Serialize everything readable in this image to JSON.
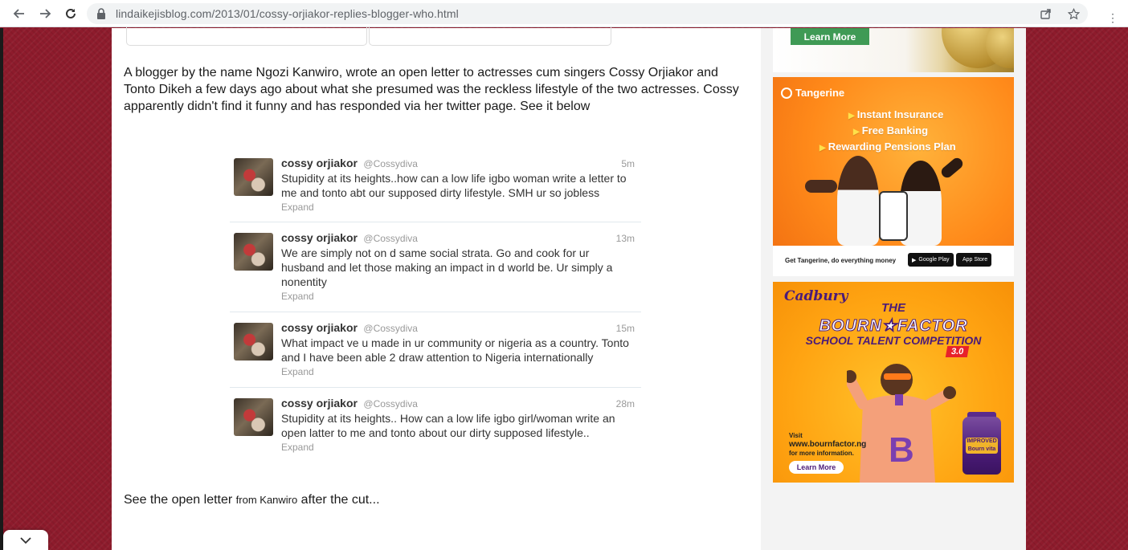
{
  "browser": {
    "url": "lindaikejisblog.com/2013/01/cossy-orjiakor-replies-blogger-who.html"
  },
  "article": {
    "intro": "A blogger by the name Ngozi Kanwiro, wrote an open letter to actresses cum singers Cossy Orjiakor and Tonto Dikeh a few days ago about what she presumed was the reckless lifestyle of the two actresses. Cossy apparently didn't find it funny and has responded via her twitter page. See it below",
    "outro_a": "See the open letter ",
    "outro_b": "from Kanwiro",
    "outro_c": " after the cut..."
  },
  "tweets": [
    {
      "name": "cossy orjiakor",
      "handle": "@Cossydiva",
      "time": "5m",
      "text": "Stupidity at its heights..how can a low life igbo woman write a letter to me and tonto abt our supposed dirty lifestyle. SMH ur so jobless",
      "expand": "Expand"
    },
    {
      "name": "cossy orjiakor",
      "handle": "@Cossydiva",
      "time": "13m",
      "text": "We are simply not on d same social strata. Go and cook for ur husband and let those making an impact in d world be. Ur simply a nonentity",
      "expand": "Expand"
    },
    {
      "name": "cossy orjiakor",
      "handle": "@Cossydiva",
      "time": "15m",
      "text": "What impact ve u made in ur community or nigeria as a country. Tonto and I have been able 2 draw attention to Nigeria internationally",
      "expand": "Expand"
    },
    {
      "name": "cossy orjiakor",
      "handle": "@Cossydiva",
      "time": "28m",
      "text": "Stupidity at its heights.. How can a low life igbo girl/woman write an open latter to me and tonto about our dirty supposed lifestyle..",
      "expand": "Expand"
    }
  ],
  "ads": {
    "top": {
      "button": "Learn More"
    },
    "tangerine": {
      "brand": "Tangerine",
      "lines": [
        "Instant Insurance",
        "Free Banking",
        "Rewarding Pensions Plan"
      ],
      "footer": "Get Tangerine, do everything money",
      "google_play": "Google Play",
      "app_store": "App Store"
    },
    "cadbury": {
      "brand": "Cadbury",
      "title1": "THE",
      "title2": "BOURN★FACTOR",
      "title3": "SCHOOL TALENT COMPETITION",
      "version": "3.0",
      "visit": "Visit",
      "url": "www.bournfactor.ng",
      "more": "for more information.",
      "button": "Learn More",
      "jar_text": "IMPROVED Bourn vita"
    }
  },
  "colors": {
    "background": "#8e1b2c",
    "tangerine": "#ff8a1a",
    "cadbury_purple": "#4b1b78",
    "cadbury_orange": "#ffa412",
    "learn_more_green": "#3f9a55"
  }
}
